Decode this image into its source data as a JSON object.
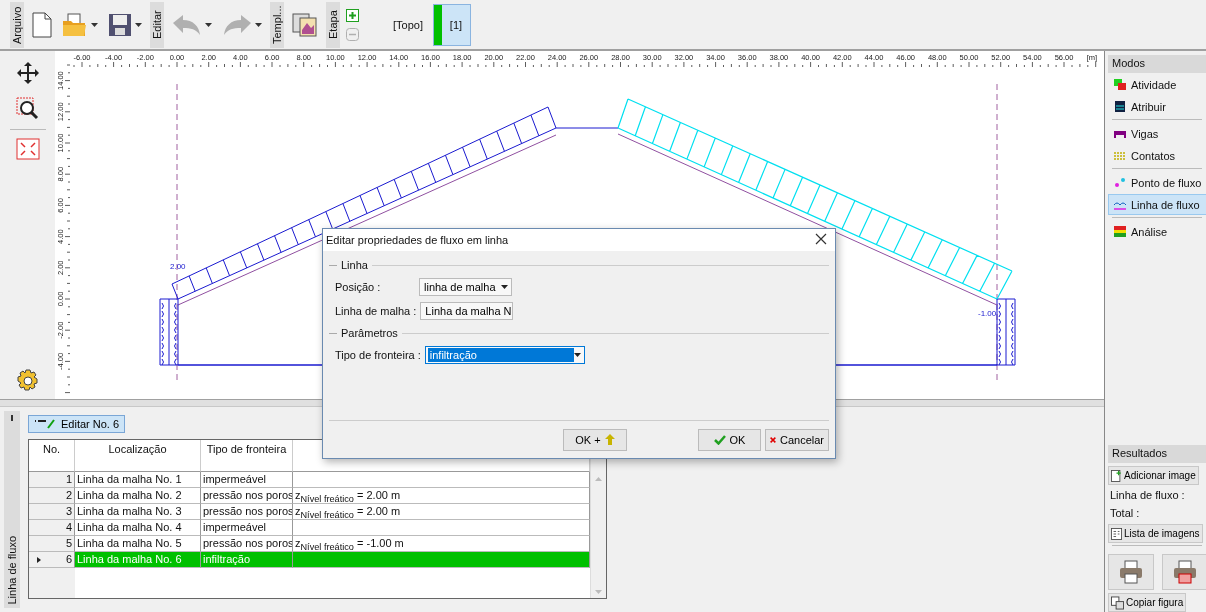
{
  "toolbar": {
    "groups": [
      {
        "label": "Arquivo"
      },
      {
        "label": "Editar"
      },
      {
        "label": "Templ..."
      },
      {
        "label": "Etapa"
      }
    ],
    "undo": {
      "disabled": true
    },
    "redo": {
      "disabled": true
    },
    "remove_stage": {
      "disabled": true
    },
    "stage_name": "[Topo]",
    "stages": [
      {
        "label": "[1]",
        "selected": true
      }
    ]
  },
  "canvas": {
    "x_ticks": [
      "-6.00",
      "-4.00",
      "-2.00",
      "0.00",
      "2.00",
      "4.00",
      "6.00",
      "8.00",
      "10.00",
      "12.00",
      "14.00",
      "16.00",
      "18.00",
      "20.00",
      "22.00",
      "24.00",
      "26.00",
      "28.00",
      "30.00",
      "32.00",
      "34.00",
      "36.00",
      "38.00",
      "40.00",
      "42.00",
      "44.00",
      "46.00",
      "48.00",
      "50.00",
      "52.00",
      "54.00",
      "56.00"
    ],
    "unit": "[m]",
    "y_ticks": [
      "14.00",
      "12.00",
      "10.00",
      "8.00",
      "6.00",
      "4.00",
      "2.00",
      "0.00",
      "-2.00",
      "-4.00"
    ],
    "point_labels": [
      "2.00",
      "-1.00"
    ]
  },
  "modes": {
    "title": "Modos",
    "groups": [
      {
        "items": [
          {
            "label": "Atividade",
            "selected": false
          },
          {
            "label": "Atribuir",
            "selected": false
          }
        ]
      },
      {
        "items": [
          {
            "label": "Vigas",
            "selected": false
          },
          {
            "label": "Contatos",
            "selected": false
          }
        ]
      },
      {
        "items": [
          {
            "label": "Ponto de fluxo",
            "selected": false
          },
          {
            "label": "Linha de fluxo",
            "selected": true
          }
        ]
      },
      {
        "items": [
          {
            "label": "Análise",
            "selected": false
          }
        ]
      }
    ]
  },
  "results": {
    "title": "Resultados",
    "add_button": "Adicionar image",
    "fields": [
      "Linha de fluxo :",
      "Total :"
    ],
    "list_button": "Lista de imagens",
    "copy_button": "Copiar figura"
  },
  "bottom": {
    "side_tab": "Linha de fluxo",
    "edit_button": "Editar No. 6",
    "table": {
      "columns": [
        "No.",
        "Localização",
        "Tipo de fronteira"
      ],
      "rows": [
        {
          "no": "1",
          "location": "Linha da malha No. 1",
          "type": "impermeável",
          "selected": false
        },
        {
          "no": "2",
          "location": "Linha da malha No. 2",
          "type": "pressão nos poros",
          "value": "z$_{Nível freático}$ = 2.00 m",
          "selected": false
        },
        {
          "no": "3",
          "location": "Linha da malha No. 3",
          "type": "pressão nos poros",
          "value": "z$_{Nível freático}$ = 2.00 m",
          "selected": false
        },
        {
          "no": "4",
          "location": "Linha da malha No. 4",
          "type": "impermeável",
          "selected": false
        },
        {
          "no": "5",
          "location": "Linha da malha No. 5",
          "type": "pressão nos poros",
          "value": "z$_{Nível freático}$ = -1.00 m",
          "selected": false
        },
        {
          "no": "6",
          "location": "Linha da malha No. 6",
          "type": "infiltração",
          "selected": true
        }
      ]
    }
  },
  "dialog": {
    "title": "Editar propriedades de fluxo em linha",
    "sections": [
      {
        "title": "Linha",
        "fields": [
          {
            "label": "Posição :",
            "value": "linha de malha",
            "focused": false
          },
          {
            "label": "Linha de malha :",
            "value": "Linha da malha N",
            "focused": false
          }
        ]
      },
      {
        "title": "Parâmetros",
        "fields": [
          {
            "label": "Tipo de fronteira :",
            "value": "infiltração",
            "focused": true
          }
        ]
      }
    ],
    "buttons": [
      {
        "label": "OK +",
        "kind": "next"
      },
      {
        "label": "OK",
        "kind": "ok"
      },
      {
        "label": "Cancelar",
        "kind": "cancel"
      }
    ]
  }
}
